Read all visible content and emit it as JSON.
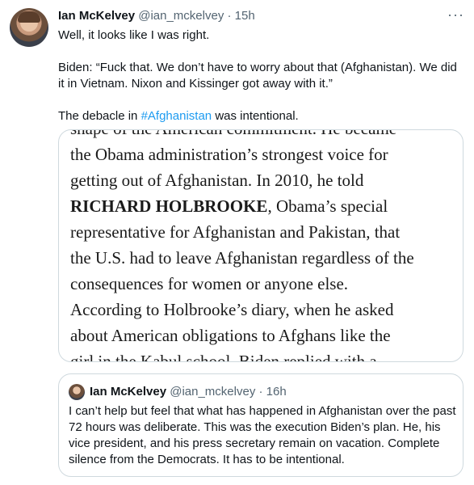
{
  "tweet": {
    "name": "Ian McKelvey",
    "handle": "@ian_mckelvey",
    "separator": "·",
    "time": "15h",
    "more": "···",
    "line1": "Well, it looks like I was right.",
    "line2": "Biden: “Fuck that. We don’t have to worry about that (Afghanistan). We did it in Vietnam. Nixon and Kissinger got away with it.”",
    "line3_prefix": "The debacle in ",
    "hashtag": "#Afghanistan",
    "line3_suffix": " was intentional."
  },
  "image": {
    "top_cut": "shape of the American commitment. He became",
    "line_a": "the Obama administration’s strongest voice for",
    "line_b": "getting out of Afghanistan. In 2010, he told",
    "line_c_bold": "RICHARD HOLBROOKE",
    "line_c_rest": ", Obama’s special",
    "line_d": "representative for Afghanistan and Pakistan, that",
    "line_e": "the U.S. had to leave Afghanistan regardless of the",
    "line_f": "consequences for women or anyone else.",
    "line_g": "According to Holbrooke’s diary, when he asked",
    "line_h": "about American obligations to Afghans like the",
    "bottom_cut": "girl in the Kabul school, Biden replied with a"
  },
  "quote": {
    "name": "Ian McKelvey",
    "handle": "@ian_mckelvey",
    "separator": "·",
    "time": "16h",
    "text": "I can’t help but feel that what has happened in Afghanistan over the past 72 hours was deliberate. This was the execution Biden’s plan. He, his vice president, and his press secretary remain on vacation. Complete silence from the Democrats. It has to be intentional."
  }
}
